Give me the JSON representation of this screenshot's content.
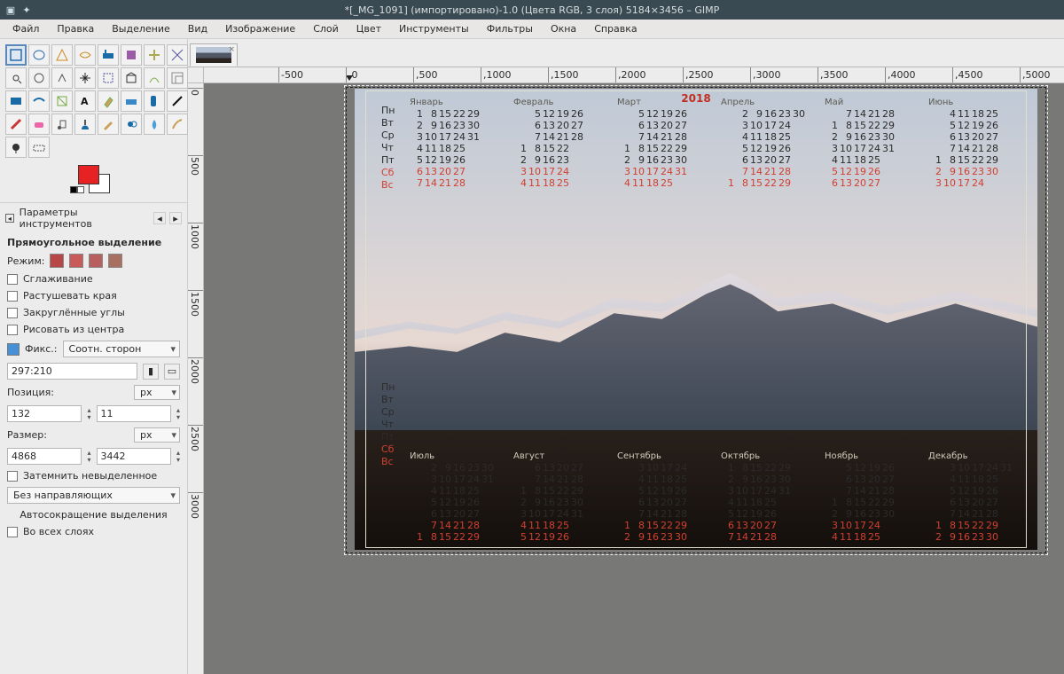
{
  "title": "*[_MG_1091] (импортировано)-1.0 (Цвета RGB, 3 слоя) 5184×3456 – GIMP",
  "menu": [
    "Файл",
    "Правка",
    "Выделение",
    "Вид",
    "Изображение",
    "Слой",
    "Цвет",
    "Инструменты",
    "Фильтры",
    "Окна",
    "Справка"
  ],
  "toolopts": {
    "header": "Параметры инструментов",
    "toolname": "Прямоугольное выделение",
    "mode_label": "Режим:",
    "antialias": "Сглаживание",
    "feather": "Растушевать края",
    "rounded": "Закруглённые углы",
    "center": "Рисовать из центра",
    "fixed_label": "Фикс.:",
    "fixed_value": "Соотн. сторон",
    "ratio": "297:210",
    "position_label": "Позиция:",
    "pos_x": "132",
    "pos_y": "11",
    "size_label": "Размер:",
    "size_w": "4868",
    "size_h": "3442",
    "dim_unit": "px",
    "darken": "Затемнить невыделенное",
    "guides": "Без направляющих",
    "autoshrink": "Автосокращение выделения",
    "alllayers": "Во всех слоях"
  },
  "swatch": {
    "fg": "#e62222",
    "bg": "#ffffff"
  },
  "tab_close": "×",
  "ruler_h": [
    "0",
    "500",
    "1000",
    "1500",
    "2000",
    "2500",
    "3000",
    "3500",
    "4000",
    "4500",
    "5000"
  ],
  "ruler_h_pre": [
    "-500"
  ],
  "ruler_v": [
    "0",
    "500",
    "1000",
    "1500",
    "2000",
    "2500",
    "3000"
  ],
  "year": "2018",
  "daynames": [
    "Пн",
    "Вт",
    "Ср",
    "Чт",
    "Пт",
    "Сб",
    "Вс"
  ],
  "months_top": [
    {
      "name": "Январь",
      "weeks": [
        [
          "1",
          "8",
          "15",
          "22",
          "29"
        ],
        [
          "2",
          "9",
          "16",
          "23",
          "30"
        ],
        [
          "3",
          "10",
          "17",
          "24",
          "31"
        ],
        [
          "4",
          "11",
          "18",
          "25",
          ""
        ],
        [
          "5",
          "12",
          "19",
          "26",
          ""
        ],
        [
          "6",
          "13",
          "20",
          "27",
          ""
        ],
        [
          "7",
          "14",
          "21",
          "28",
          ""
        ]
      ]
    },
    {
      "name": "Февраль",
      "weeks": [
        [
          "",
          "5",
          "12",
          "19",
          "26"
        ],
        [
          "",
          "6",
          "13",
          "20",
          "27"
        ],
        [
          "",
          "7",
          "14",
          "21",
          "28"
        ],
        [
          "1",
          "8",
          "15",
          "22",
          ""
        ],
        [
          "2",
          "9",
          "16",
          "23",
          ""
        ],
        [
          "3",
          "10",
          "17",
          "24",
          ""
        ],
        [
          "4",
          "11",
          "18",
          "25",
          ""
        ]
      ]
    },
    {
      "name": "Март",
      "weeks": [
        [
          "",
          "5",
          "12",
          "19",
          "26"
        ],
        [
          "",
          "6",
          "13",
          "20",
          "27"
        ],
        [
          "",
          "7",
          "14",
          "21",
          "28"
        ],
        [
          "1",
          "8",
          "15",
          "22",
          "29"
        ],
        [
          "2",
          "9",
          "16",
          "23",
          "30"
        ],
        [
          "3",
          "10",
          "17",
          "24",
          "31"
        ],
        [
          "4",
          "11",
          "18",
          "25",
          ""
        ]
      ]
    },
    {
      "name": "Апрель",
      "weeks": [
        [
          "",
          "2",
          "9",
          "16",
          "23",
          "30"
        ],
        [
          "",
          "3",
          "10",
          "17",
          "24",
          ""
        ],
        [
          "",
          "4",
          "11",
          "18",
          "25",
          ""
        ],
        [
          "",
          "5",
          "12",
          "19",
          "26",
          ""
        ],
        [
          "",
          "6",
          "13",
          "20",
          "27",
          ""
        ],
        [
          "",
          "7",
          "14",
          "21",
          "28",
          ""
        ],
        [
          "1",
          "8",
          "15",
          "22",
          "29",
          ""
        ]
      ]
    },
    {
      "name": "Май",
      "weeks": [
        [
          "",
          "7",
          "14",
          "21",
          "28"
        ],
        [
          "1",
          "8",
          "15",
          "22",
          "29"
        ],
        [
          "2",
          "9",
          "16",
          "23",
          "30"
        ],
        [
          "3",
          "10",
          "17",
          "24",
          "31"
        ],
        [
          "4",
          "11",
          "18",
          "25",
          ""
        ],
        [
          "5",
          "12",
          "19",
          "26",
          ""
        ],
        [
          "6",
          "13",
          "20",
          "27",
          ""
        ]
      ]
    },
    {
      "name": "Июнь",
      "weeks": [
        [
          "",
          "4",
          "11",
          "18",
          "25"
        ],
        [
          "",
          "5",
          "12",
          "19",
          "26"
        ],
        [
          "",
          "6",
          "13",
          "20",
          "27"
        ],
        [
          "",
          "7",
          "14",
          "21",
          "28"
        ],
        [
          "1",
          "8",
          "15",
          "22",
          "29"
        ],
        [
          "2",
          "9",
          "16",
          "23",
          "30"
        ],
        [
          "3",
          "10",
          "17",
          "24",
          ""
        ]
      ]
    }
  ],
  "months_bot": [
    {
      "name": "Июль",
      "weeks": [
        [
          "",
          "2",
          "9",
          "16",
          "23",
          "30"
        ],
        [
          "",
          "3",
          "10",
          "17",
          "24",
          "31"
        ],
        [
          "",
          "4",
          "11",
          "18",
          "25",
          ""
        ],
        [
          "",
          "5",
          "12",
          "19",
          "26",
          ""
        ],
        [
          "",
          "6",
          "13",
          "20",
          "27",
          ""
        ],
        [
          "",
          "7",
          "14",
          "21",
          "28",
          ""
        ],
        [
          "1",
          "8",
          "15",
          "22",
          "29",
          ""
        ]
      ]
    },
    {
      "name": "Август",
      "weeks": [
        [
          "",
          "6",
          "13",
          "20",
          "27"
        ],
        [
          "",
          "7",
          "14",
          "21",
          "28"
        ],
        [
          "1",
          "8",
          "15",
          "22",
          "29"
        ],
        [
          "2",
          "9",
          "16",
          "23",
          "30"
        ],
        [
          "3",
          "10",
          "17",
          "24",
          "31"
        ],
        [
          "4",
          "11",
          "18",
          "25",
          ""
        ],
        [
          "5",
          "12",
          "19",
          "26",
          ""
        ]
      ]
    },
    {
      "name": "Сентябрь",
      "weeks": [
        [
          "",
          "3",
          "10",
          "17",
          "24"
        ],
        [
          "",
          "4",
          "11",
          "18",
          "25"
        ],
        [
          "",
          "5",
          "12",
          "19",
          "26"
        ],
        [
          "",
          "6",
          "13",
          "20",
          "27"
        ],
        [
          "",
          "7",
          "14",
          "21",
          "28"
        ],
        [
          "1",
          "8",
          "15",
          "22",
          "29"
        ],
        [
          "2",
          "9",
          "16",
          "23",
          "30"
        ]
      ]
    },
    {
      "name": "Октябрь",
      "weeks": [
        [
          "1",
          "8",
          "15",
          "22",
          "29"
        ],
        [
          "2",
          "9",
          "16",
          "23",
          "30"
        ],
        [
          "3",
          "10",
          "17",
          "24",
          "31"
        ],
        [
          "4",
          "11",
          "18",
          "25",
          ""
        ],
        [
          "5",
          "12",
          "19",
          "26",
          ""
        ],
        [
          "6",
          "13",
          "20",
          "27",
          ""
        ],
        [
          "7",
          "14",
          "21",
          "28",
          ""
        ]
      ]
    },
    {
      "name": "Ноябрь",
      "weeks": [
        [
          "",
          "5",
          "12",
          "19",
          "26"
        ],
        [
          "",
          "6",
          "13",
          "20",
          "27"
        ],
        [
          "",
          "7",
          "14",
          "21",
          "28"
        ],
        [
          "1",
          "8",
          "15",
          "22",
          "29"
        ],
        [
          "2",
          "9",
          "16",
          "23",
          "30"
        ],
        [
          "3",
          "10",
          "17",
          "24",
          ""
        ],
        [
          "4",
          "11",
          "18",
          "25",
          ""
        ]
      ]
    },
    {
      "name": "Декабрь",
      "weeks": [
        [
          "",
          "3",
          "10",
          "17",
          "24",
          "31"
        ],
        [
          "",
          "4",
          "11",
          "18",
          "25",
          ""
        ],
        [
          "",
          "5",
          "12",
          "19",
          "26",
          ""
        ],
        [
          "",
          "6",
          "13",
          "20",
          "27",
          ""
        ],
        [
          "",
          "7",
          "14",
          "21",
          "28",
          ""
        ],
        [
          "1",
          "8",
          "15",
          "22",
          "29",
          ""
        ],
        [
          "2",
          "9",
          "16",
          "23",
          "30",
          ""
        ]
      ]
    }
  ]
}
